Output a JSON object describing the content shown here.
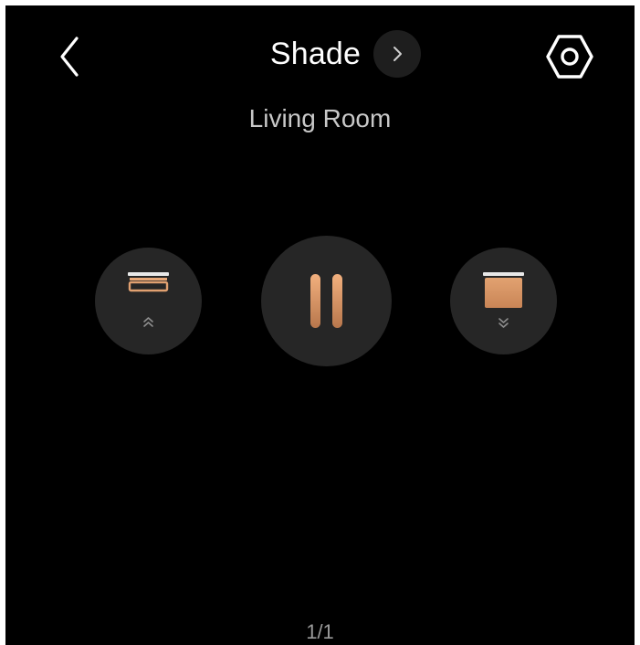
{
  "header": {
    "title": "Shade",
    "back_icon": "chevron-left-icon",
    "title_chevron_icon": "chevron-right-icon",
    "settings_icon": "hexagon-settings-icon"
  },
  "room": "Living Room",
  "controls": [
    {
      "name": "open",
      "icon": "shade-open-icon"
    },
    {
      "name": "pause",
      "icon": "pause-icon"
    },
    {
      "name": "close",
      "icon": "shade-close-icon"
    }
  ],
  "pager": "1/1",
  "colors": {
    "background": "#000000",
    "button_bg": "#262626",
    "accent": "#d9956a",
    "accent_dark": "#b8774c",
    "text_secondary": "#c8c8c8"
  }
}
